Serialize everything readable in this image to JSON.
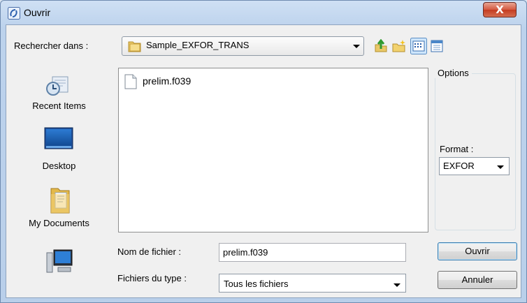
{
  "window": {
    "title": "Ouvrir",
    "close_glyph": "X"
  },
  "toolbar": {
    "look_in_label": "Rechercher dans :",
    "look_in_value": "Sample_EXFOR_TRANS",
    "icons": [
      "folder-up-icon",
      "new-folder-icon",
      "view-list-icon",
      "view-details-icon"
    ]
  },
  "places": [
    {
      "label": "Recent Items",
      "icon": "recent-items-icon"
    },
    {
      "label": "Desktop",
      "icon": "desktop-icon"
    },
    {
      "label": "My Documents",
      "icon": "my-documents-icon"
    },
    {
      "label": "",
      "icon": "computer-icon"
    }
  ],
  "files": [
    {
      "name": "prelim.f039",
      "icon": "file-icon"
    }
  ],
  "options": {
    "title": "Options",
    "format_label": "Format :",
    "format_value": "EXFOR"
  },
  "filename": {
    "label": "Nom de fichier :",
    "value": "prelim.f039"
  },
  "filetype": {
    "label": "Fichiers du type :",
    "value": "Tous les fichiers"
  },
  "buttons": {
    "open": "Ouvrir",
    "cancel": "Annuler"
  }
}
